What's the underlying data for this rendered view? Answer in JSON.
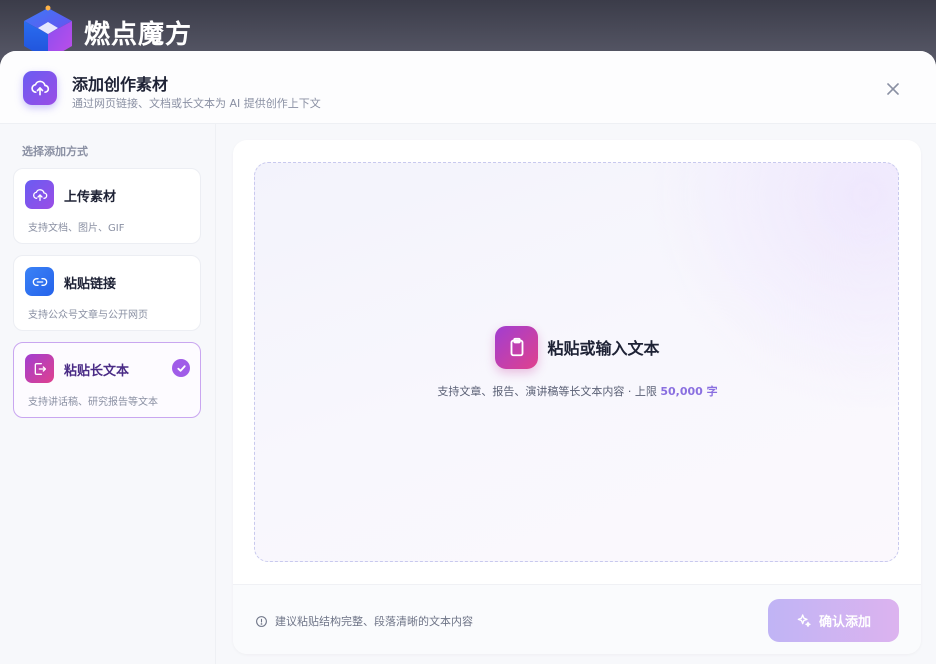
{
  "app": {
    "name": "燃点魔方",
    "logo_icon": "cube-logo-icon"
  },
  "modal": {
    "title": "添加创作素材",
    "subtitle": "通过网页链接、文档或长文本为 AI 提供创作上下文",
    "header_icon": "cloud-upload-icon",
    "close_icon": "close-icon"
  },
  "sidebar": {
    "label": "选择添加方式",
    "options": [
      {
        "title": "上传素材",
        "desc": "支持文档、图片、GIF",
        "icon": "cloud-upload-icon",
        "color": "#7b55e8"
      },
      {
        "title": "粘贴链接",
        "desc": "支持公众号文章与公开网页",
        "icon": "link-icon",
        "color": "#3b82f6"
      },
      {
        "title": "粘贴长文本",
        "desc": "支持讲话稿、研究报告等文本",
        "icon": "paste-text-icon",
        "color": "#c43fb6",
        "selected": true
      }
    ]
  },
  "dropzone": {
    "title": "粘贴或输入文本",
    "subtitle_prefix": "支持文章、报告、演讲稿等长文本内容 · 上限",
    "limit": "50,000 字",
    "icon": "clipboard-icon"
  },
  "footer": {
    "tip": "建议粘贴结构完整、段落清晰的文本内容",
    "tip_icon": "info-icon",
    "confirm_label": "确认添加",
    "confirm_icon": "sparkle-icon"
  },
  "colors": {
    "accent": "#7b55e8",
    "selected_border": "#c9a6f0",
    "highlight": "#8a6fe0"
  }
}
